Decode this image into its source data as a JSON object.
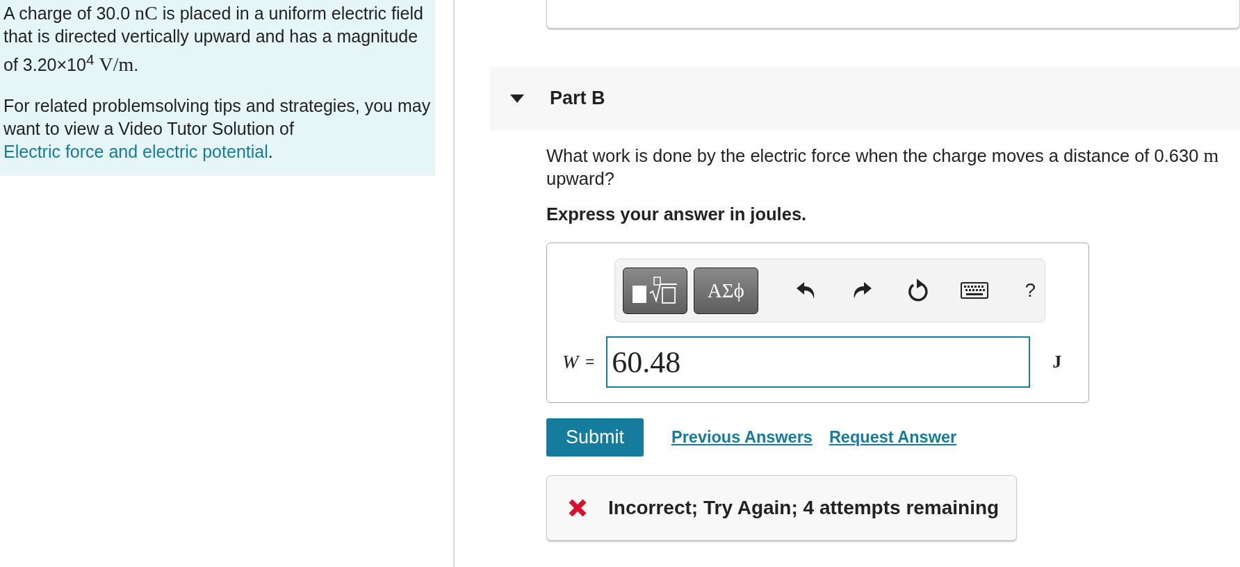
{
  "problem": {
    "statement": [
      {
        "kind": "text",
        "text": "A charge of 30.0 "
      },
      {
        "kind": "math",
        "text": "nC"
      },
      {
        "kind": "text",
        "text": " is placed in a uniform electric field that is directed vertically upward and has a magnitude of 3.20×10$^{4}$ "
      },
      {
        "kind": "math",
        "text": "V/m"
      },
      {
        "kind": "text",
        "text": "."
      }
    ],
    "tip": [
      {
        "kind": "text",
        "text": "For related problemsolving tips and strategies, you may want to view a Video Tutor Solution of "
      },
      {
        "kind": "link",
        "text": "Electric force and electric potential"
      },
      {
        "kind": "text",
        "text": "."
      }
    ]
  },
  "part": {
    "title": "Part B",
    "expanded": true,
    "question": [
      {
        "kind": "text",
        "text": "What work is done by the electric force when the charge moves a distance of 0.630 "
      },
      {
        "kind": "math",
        "text": "m"
      },
      {
        "kind": "text",
        "text": " upward?"
      }
    ],
    "instruction": "Express your answer in joules.",
    "toolbar": [
      {
        "kind": "templates"
      },
      {
        "kind": "symbols",
        "label": "ΑΣϕ"
      },
      {
        "kind": "undo"
      },
      {
        "kind": "redo"
      },
      {
        "kind": "reset"
      },
      {
        "kind": "keyboard"
      },
      {
        "kind": "help",
        "label": "?"
      }
    ],
    "variable": "W",
    "equals": "=",
    "value": "60.48",
    "unit": "J",
    "submit": "Submit",
    "links": [
      "Previous Answers",
      "Request Answer"
    ],
    "feedback": {
      "correct": false,
      "message": "Incorrect; Try Again; 4 attempts remaining"
    }
  }
}
